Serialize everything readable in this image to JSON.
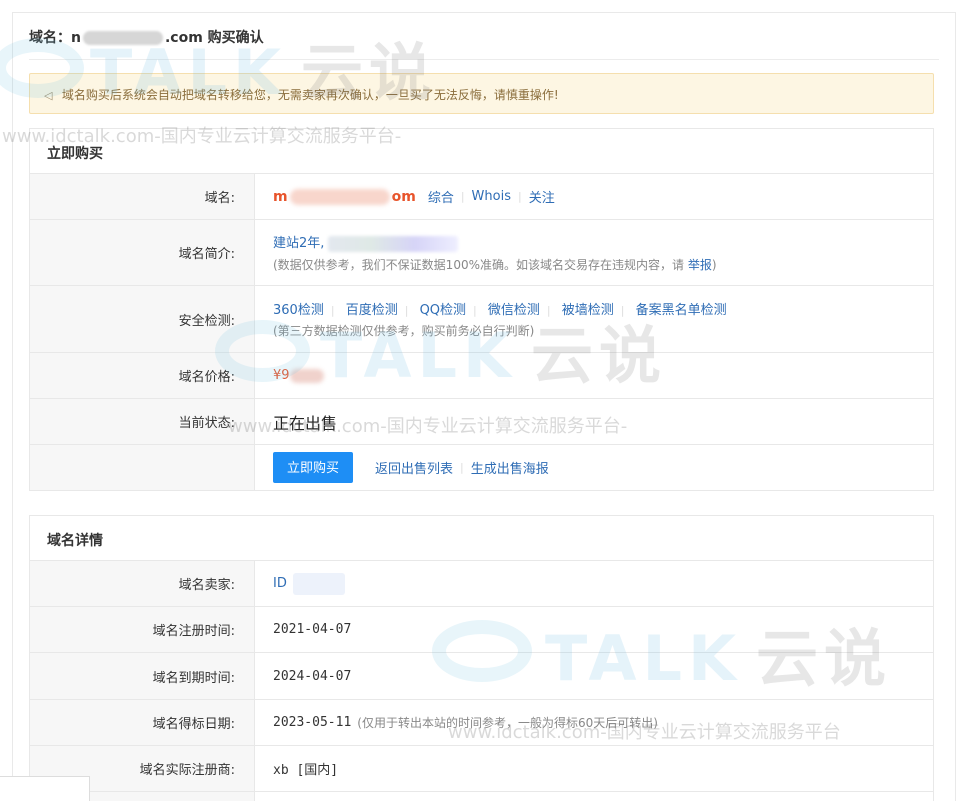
{
  "page": {
    "title_prefix": "域名：n",
    "title_suffix": ".com 购买确认"
  },
  "notice": {
    "icon": "speaker-icon",
    "text": "域名购买后系统会自动把域名转移给您，无需卖家再次确认，一旦买了无法反悔，请慎重操作!"
  },
  "buy_panel": {
    "heading": "立即购买",
    "domain": {
      "label": "域名:",
      "name_prefix": "m",
      "name_suffix": "om",
      "links": [
        "综合",
        "Whois",
        "关注"
      ]
    },
    "intro": {
      "label": "域名简介:",
      "text": "建站2年,",
      "note_prefix": "(数据仅供参考，我们不保证数据100%准确。如该域名交易存在违规内容，请 ",
      "report_link": "举报",
      "note_suffix": ")"
    },
    "security": {
      "label": "安全检测:",
      "links": [
        "360检测",
        "百度检测",
        "QQ检测",
        "微信检测",
        "被墙检测",
        "备案黑名单检测"
      ],
      "note": "(第三方数据检测仅供参考，购买前务必自行判断)"
    },
    "price": {
      "label": "域名价格:",
      "value": "¥9"
    },
    "status": {
      "label": "当前状态:",
      "value": "正在出售"
    },
    "actions": {
      "buy_button": "立即购买",
      "back_link": "返回出售列表",
      "poster_link": "生成出售海报"
    }
  },
  "detail_panel": {
    "heading": "域名详情",
    "rows": [
      {
        "label": "域名卖家:",
        "value": "ID"
      },
      {
        "label": "域名注册时间:",
        "value": "2021-04-07"
      },
      {
        "label": "域名到期时间:",
        "value": "2024-04-07"
      },
      {
        "label": "域名得标日期:",
        "value": "2023-05-11",
        "note": "(仅用于转出本站的时间参考，一般为得标60天后可转出)"
      },
      {
        "label": "域名实际注册商:",
        "value": "xb [国内]"
      }
    ]
  },
  "watermark": {
    "site_text": "www.idctalk.com-国内专业云计算交流服务平台-",
    "site_text_2": "www.idctalk.com-国内专业云计算交流服务平台-",
    "site_text_3": "www.idctalk.com-国内专业云计算交流服务平台",
    "logo_text": "TALK",
    "logo_cn": "云说"
  },
  "colors": {
    "accent": "#1e8ef5",
    "link": "#2f6db5",
    "price": "#e8542b",
    "notice_bg": "#fdf6e3"
  }
}
